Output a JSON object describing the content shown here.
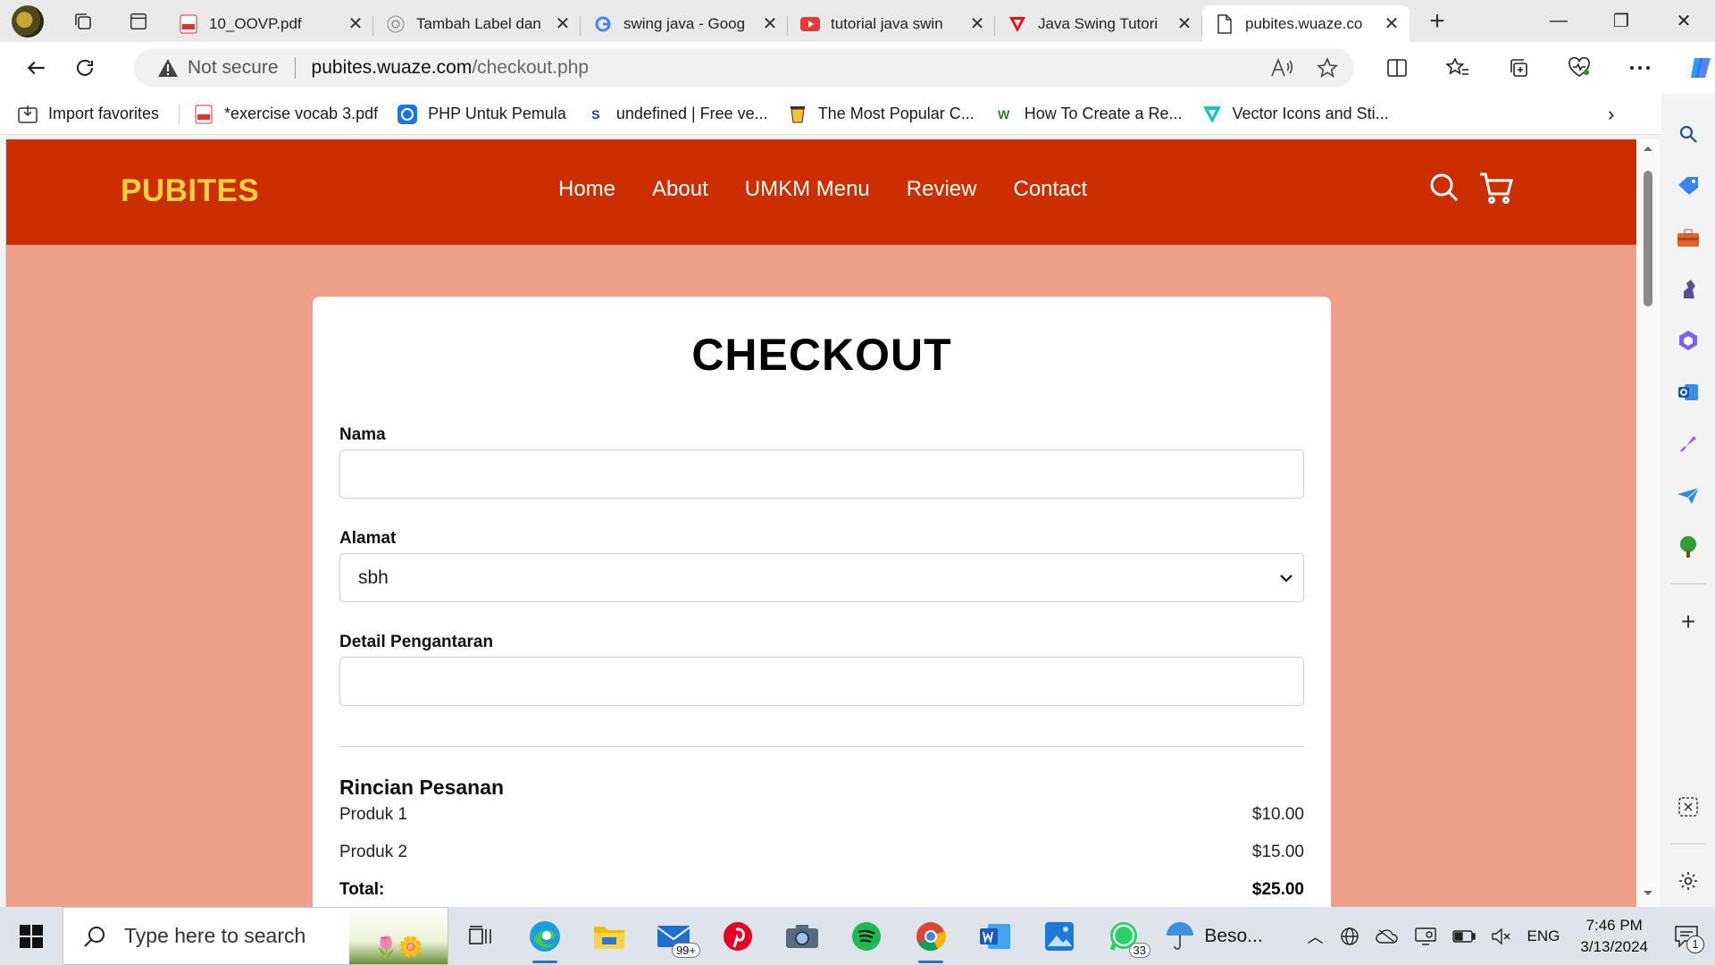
{
  "browser": {
    "tabs": [
      {
        "title": "10_OOVP.pdf",
        "icon": "pdf-icon",
        "active": false
      },
      {
        "title": "Tambah Label dan",
        "icon": "chatgpt-icon",
        "active": false
      },
      {
        "title": "swing java - Goog",
        "icon": "google-icon",
        "active": false
      },
      {
        "title": "tutorial java swin",
        "icon": "youtube-icon",
        "active": false
      },
      {
        "title": "Java Swing Tutori",
        "icon": "tutorial-site-icon",
        "active": false
      },
      {
        "title": "pubites.wuaze.co",
        "icon": "page-icon",
        "active": true
      }
    ],
    "address": {
      "security_label": "Not secure",
      "host": "pubites.wuaze.com",
      "path": "/checkout.php"
    },
    "favorites": [
      {
        "label": "Import favorites",
        "icon": "import-icon"
      },
      {
        "label": "*exercise vocab 3.pdf",
        "icon": "pdf-icon"
      },
      {
        "label": "PHP Untuk Pemula",
        "icon": "php-icon"
      },
      {
        "label": "undefined | Free ve...",
        "icon": "s-icon"
      },
      {
        "label": "The Most Popular C...",
        "icon": "cup-icon"
      },
      {
        "label": "How To Create a Re...",
        "icon": "w-icon"
      },
      {
        "label": "Vector Icons and Sti...",
        "icon": "vector-icon"
      }
    ]
  },
  "site": {
    "brand": "PUBITES",
    "nav": [
      "Home",
      "About",
      "UMKM Menu",
      "Review",
      "Contact"
    ]
  },
  "checkout": {
    "title": "CHECKOUT",
    "fields": {
      "nama_label": "Nama",
      "nama_value": "",
      "alamat_label": "Alamat",
      "alamat_value": "sbh",
      "detail_label": "Detail Pengantaran",
      "detail_value": ""
    },
    "order": {
      "title": "Rincian Pesanan",
      "items": [
        {
          "name": "Produk 1",
          "price": "$10.00"
        },
        {
          "name": "Produk 2",
          "price": "$15.00"
        }
      ],
      "total_label": "Total:",
      "total_value": "$25.00"
    }
  },
  "taskbar": {
    "search_placeholder": "Type here to search",
    "mail_badge": "99+",
    "whatsapp_badge": "33",
    "weather_label": "Beso...",
    "language": "ENG",
    "time": "7:46 PM",
    "date": "3/13/2024",
    "notification_count": "1"
  },
  "colors": {
    "header_red": "#cc2e00",
    "brand_yellow": "#ffd53d",
    "page_bg_salmon": "#ee9f89"
  }
}
